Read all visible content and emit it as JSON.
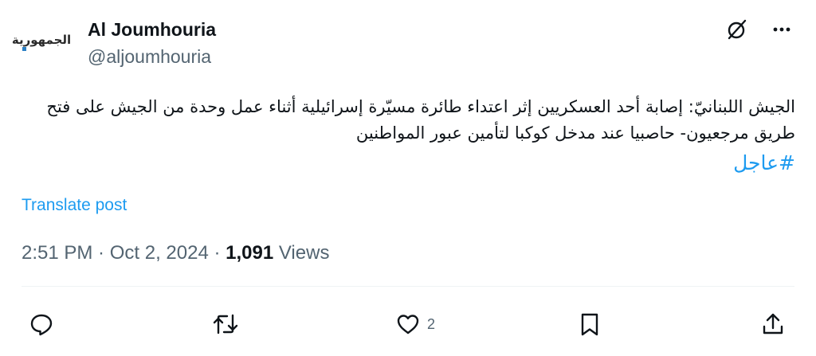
{
  "author": {
    "display_name": "Al Joumhouria",
    "handle": "@aljoumhouria",
    "avatar_logo_text": "الجمهورية"
  },
  "header_icons": [
    "grok-icon",
    "more-icon"
  ],
  "tweet": {
    "text": "الجيش اللبنانيّ: إصابة أحد العسكريين إثر اعتداء طائرة مسيّرة إسرائيلية أثناء عمل وحدة من الجيش على فتح طريق مرجعيون- حاصبيا عند مدخل كوكبا لتأمين عبور المواطنين",
    "hashtag": "#عاجل"
  },
  "translate_label": "Translate post",
  "meta": {
    "time": "2:51 PM",
    "separator": " · ",
    "date": "Oct 2, 2024",
    "separator2": " · ",
    "views_count": "1,091",
    "views_label": " Views"
  },
  "actions": {
    "reply": {
      "icon": "reply-icon",
      "count": ""
    },
    "repost": {
      "icon": "repost-icon",
      "count": ""
    },
    "like": {
      "icon": "heart-icon",
      "count": "2"
    },
    "bookmark": {
      "icon": "bookmark-icon",
      "count": ""
    },
    "share": {
      "icon": "share-icon",
      "count": ""
    }
  },
  "colors": {
    "link": "#1d9bf0",
    "secondary_text": "#536471",
    "primary_text": "#0f1419"
  }
}
